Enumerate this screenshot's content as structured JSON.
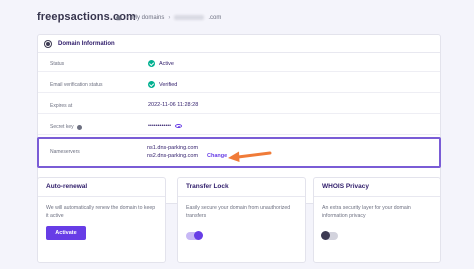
{
  "header": {
    "domain_title": "freepsactions.com",
    "breadcrumb_sep": "›",
    "breadcrumb_my_domains": "My domains",
    "breadcrumb_current_suffix": ".com"
  },
  "info": {
    "title": "Domain Information",
    "status_label": "Status",
    "status_value": "Active",
    "email_label": "Email verification status",
    "email_value": "Verified",
    "expires_label": "Expires at",
    "expires_value": "2022-11-06 11:28:28",
    "secret_label": "Secret key",
    "secret_value": "••••••••••••",
    "nameservers_label": "Nameservers",
    "ns1": "ns1.dns-parking.com",
    "ns2": "ns2.dns-parking.com",
    "change_label": "Change"
  },
  "cards": {
    "auto_renewal": {
      "title": "Auto-renewal",
      "desc": "We will automatically renew the domain to keep it active",
      "button": "Activate"
    },
    "transfer_lock": {
      "title": "Transfer Lock",
      "desc": "Easily secure your domain from unauthorized transfers",
      "toggle_on": true
    },
    "whois": {
      "title": "WHOIS Privacy",
      "desc": "An extra security layer for your domain information privacy",
      "toggle_on": false
    }
  },
  "colors": {
    "accent": "#673de6",
    "success": "#00b090",
    "highlight_arrow": "#f07b38"
  }
}
